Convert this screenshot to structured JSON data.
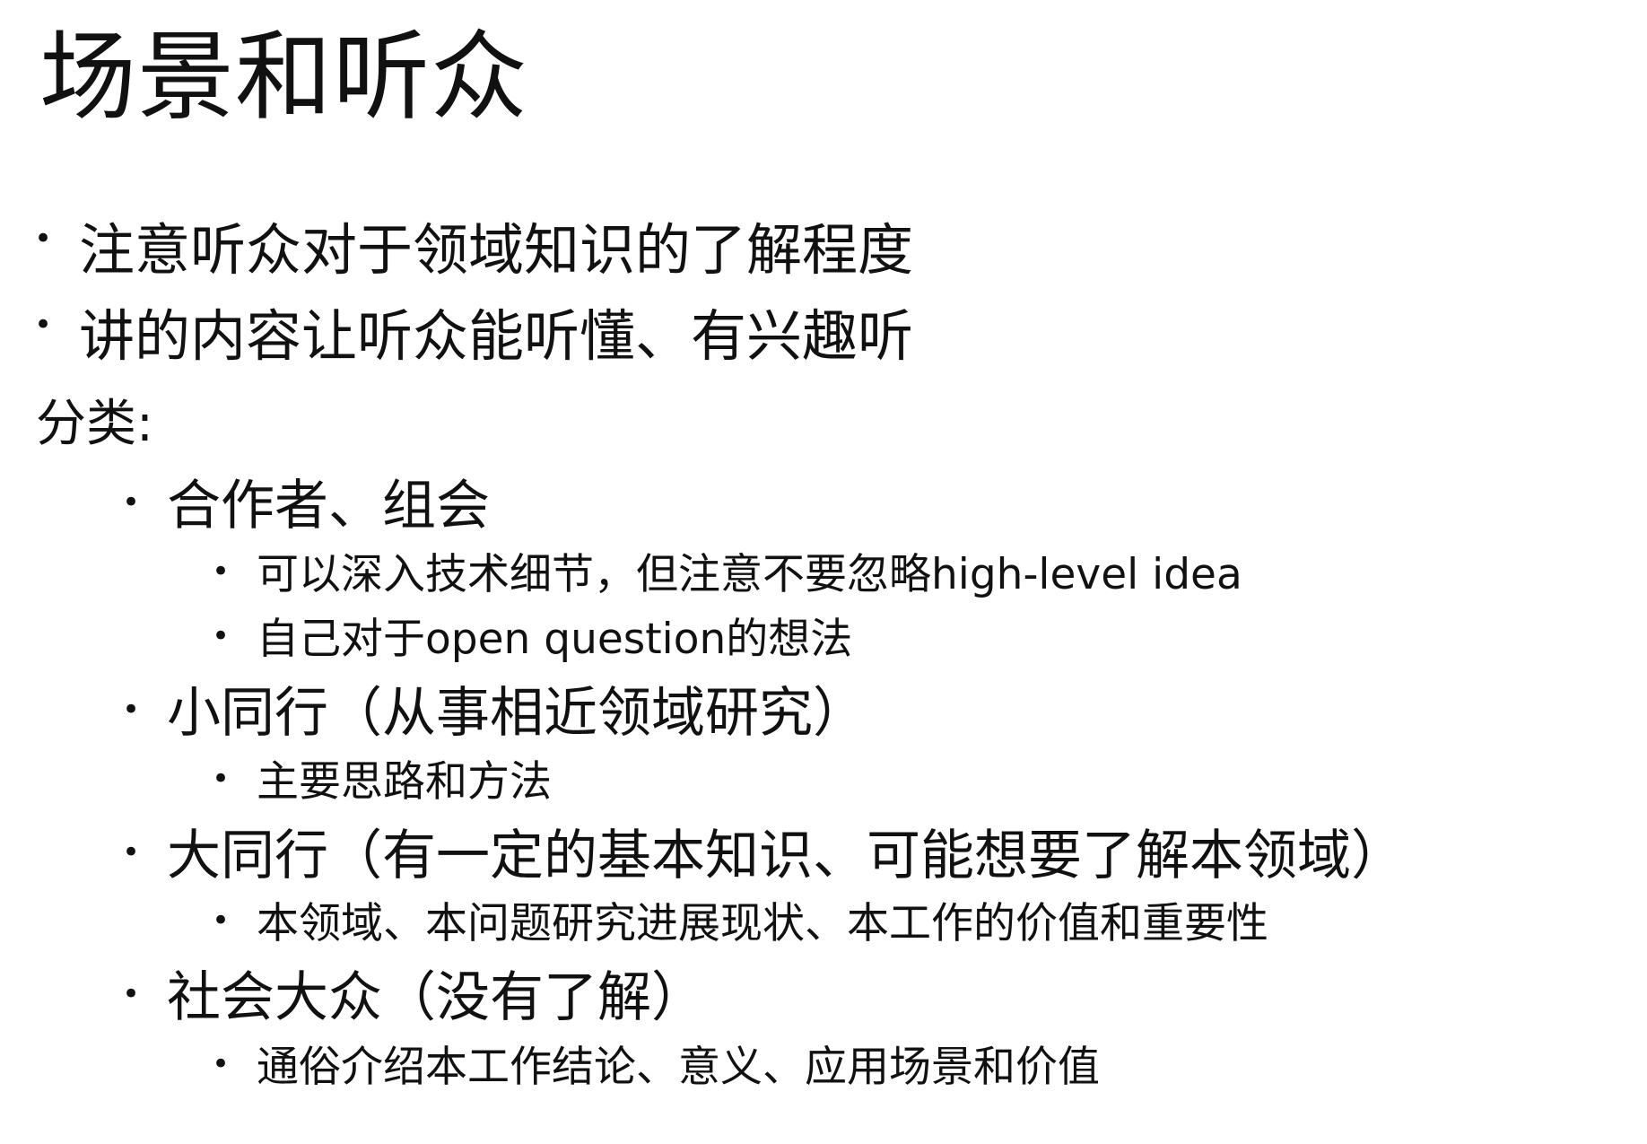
{
  "slide": {
    "title": "场景和听众",
    "bullet_glyph": "•",
    "top_points": [
      "注意听众对于领域知识的了解程度",
      "讲的内容让听众能听懂、有兴趣听"
    ],
    "category_label": "分类:",
    "categories": [
      {
        "label": "合作者、组会",
        "subitems": [
          "可以深入技术细节，但注意不要忽略high-level idea",
          "自己对于open question的想法"
        ]
      },
      {
        "label": "小同行（从事相近领域研究）",
        "subitems": [
          "主要思路和方法"
        ]
      },
      {
        "label": "大同行（有一定的基本知识、可能想要了解本领域）",
        "subitems": [
          "本领域、本问题研究进展现状、本工作的价值和重要性"
        ]
      },
      {
        "label": "社会大众（没有了解）",
        "subitems": [
          "通俗介绍本工作结论、意义、应用场景和价值"
        ]
      }
    ]
  }
}
